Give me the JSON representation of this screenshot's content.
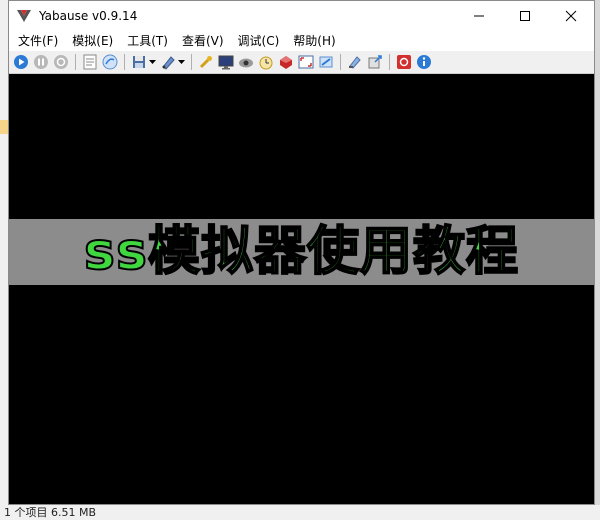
{
  "window": {
    "title": "Yabause v0.9.14",
    "controls": {
      "minimize": "minimize",
      "maximize": "maximize",
      "close": "close"
    }
  },
  "menu": [
    "文件(F)",
    "模拟(E)",
    "工具(T)",
    "查看(V)",
    "调试(C)",
    "帮助(H)"
  ],
  "toolbar": {
    "icons": [
      "play-icon",
      "pause-icon",
      "reset-icon",
      "cd-icon",
      "iso-icon",
      "save-state-icon",
      "load-state-icon",
      "settings-icon",
      "display-icon",
      "eye-icon",
      "clock-icon",
      "record-icon",
      "fullscreen-icon",
      "screenshot-icon",
      "memory-icon",
      "export-icon",
      "stop-icon",
      "about-icon"
    ]
  },
  "overlay": {
    "banner_text": "ss模拟器使用教程"
  },
  "background": {
    "status_text": "1 个项目  6.51 MB"
  },
  "colors": {
    "screen": "#000000",
    "banner_bg": "#8c8c8c",
    "banner_text": "#3fd63f"
  }
}
